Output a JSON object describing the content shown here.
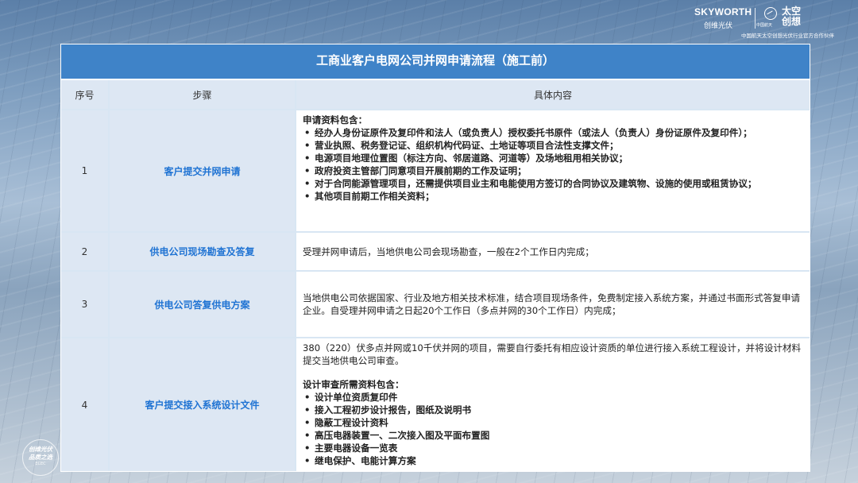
{
  "brand": {
    "name": "SKYWORTH",
    "name_cn": "创维光伏",
    "space_brand": "太空\n创想",
    "space_sub": "中国航天",
    "partner_line": "中国航天太空创想光伏行业官方合作伙伴"
  },
  "stamp": {
    "line1": "创维光伏",
    "line2": "品质之选",
    "line3": "ECEC"
  },
  "table": {
    "title": "工商业客户电网公司并网申请流程（施工前）",
    "headers": {
      "num": "序号",
      "step": "步骤",
      "detail": "具体内容"
    },
    "rows": [
      {
        "num": "1",
        "step": "客户提交并网申请",
        "intro": "申请资料包含：",
        "bullets": [
          "经办人身份证原件及复印件和法人（或负责人）授权委托书原件（或法人（负责人）身份证原件及复印件）；",
          "营业执照、税务登记证、组织机构代码证、土地证等项目合法性支撑文件；",
          "电源项目地理位置图（标注方向、邻居道路、河道等）及场地租用相关协议；",
          "政府投资主管部门同意项目开展前期的工作及证明；",
          "对于合同能源管理项目，还需提供项目业主和电能使用方签订的合同协议及建筑物、设施的使用或租赁协议；",
          "其他项目前期工作相关资料；"
        ]
      },
      {
        "num": "2",
        "step": "供电公司现场勘查及答复",
        "text": "受理并网申请后，当地供电公司会现场勘查，一般在2个工作日内完成；"
      },
      {
        "num": "3",
        "step": "供电公司答复供电方案",
        "text": "当地供电公司依据国家、行业及地方相关技术标准，结合项目现场条件，免费制定接入系统方案，并通过书面形式答复申请企业。自受理并网申请之日起20个工作日（多点并网的30个工作日）内完成；"
      },
      {
        "num": "4",
        "step": "客户提交接入系统设计文件",
        "text": "380（220）伏多点并网或10千伏并网的项目，需要自行委托有相应设计资质的单位进行接入系统工程设计，并将设计材料提交当地供电公司审查。",
        "intro": "设计审查所需资料包含：",
        "bullets": [
          "设计单位资质复印件",
          "接入工程初步设计报告，图纸及说明书",
          "隐蔽工程设计资料",
          "高压电器装置一、二次接入图及平面布置图",
          "主要电器设备一览表",
          "继电保护、电能计算方案"
        ]
      }
    ]
  }
}
